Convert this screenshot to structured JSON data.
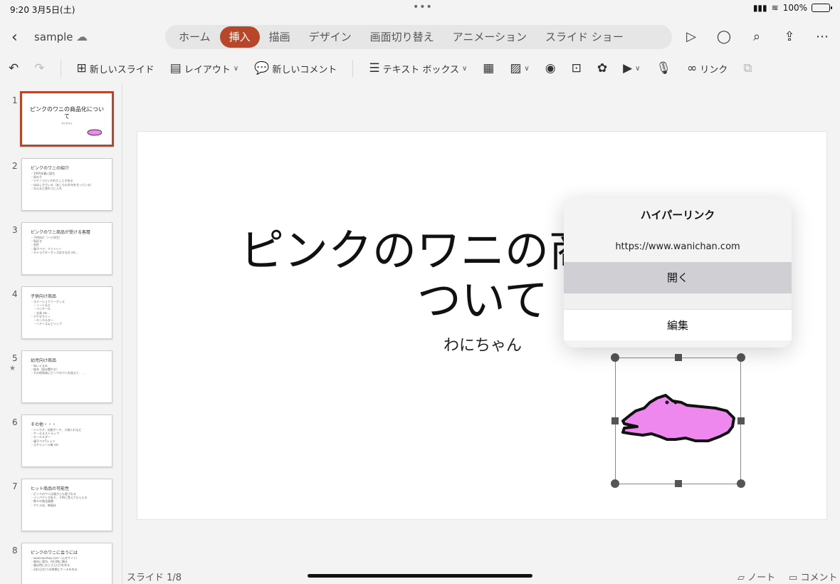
{
  "status": {
    "time": "9:20",
    "date": "3月5日(土)",
    "battery": "100%"
  },
  "document": {
    "name": "sample"
  },
  "tabs": [
    {
      "label": "ホーム",
      "active": false
    },
    {
      "label": "挿入",
      "active": true
    },
    {
      "label": "描画",
      "active": false
    },
    {
      "label": "デザイン",
      "active": false
    },
    {
      "label": "画面切り替え",
      "active": false
    },
    {
      "label": "アニメーション",
      "active": false
    },
    {
      "label": "スライド ショー",
      "active": false
    }
  ],
  "ribbon": {
    "new_slide": "新しいスライド",
    "layout": "レイアウト",
    "new_comment": "新しいコメント",
    "textbox": "テキスト ボックス",
    "link": "リンク"
  },
  "thumbnails": [
    {
      "num": "1",
      "title": "ピンクのワニの商品化について",
      "lines": [
        "わにちゃん"
      ]
    },
    {
      "num": "2",
      "title": "ピンクのワニの紹介",
      "lines": [
        "・1995年春に誕生",
        "・男の子",
        "・ツチノコといわれたことがある",
        "・ほほしかでいる（あこもの文句を言っている）",
        "・ひんなど表れうに入れ"
      ]
    },
    {
      "num": "3",
      "title": "ピンクのワニ商品が受ける客層",
      "lines": [
        "・子供向け（～小学生）",
        "・私好き",
        "・女性",
        "・親子ペア、ファミリー",
        "・キャラクターグッズ好きな方 etc..."
      ]
    },
    {
      "num": "4",
      "title": "子供向け商品",
      "lines": [
        "・ステーショナリーグッズ",
        "　・ノートなど",
        "　・ペンケース",
        "　・文具 etc...",
        "・アクセサリー",
        "　・キーホルダー",
        "　・ヘアーゴムとリップ"
      ]
    },
    {
      "num": "5",
      "title": "幼児向け商品",
      "lines": [
        "・ぬいぐるみ",
        "・絵本（読み聞かせ）",
        "・その他知育にピンクのワニを加えて．．．"
      ]
    },
    {
      "num": "6",
      "title": "その他・・・",
      "lines": [
        "・ハンカチ、化粧ポーチ、小物入れなど",
        "・ケーキ＆ストラップ",
        "・キーホルダー",
        "・親子ペアTシャツ",
        "・スケジュール帳 etc"
      ]
    },
    {
      "num": "7",
      "title": "ヒット商品の可能性",
      "lines": [
        "・ピンクのワニは誰からも愛される",
        "・インパクトがあり、子供に覚えてもらえる",
        "・数々の商品展開",
        "・アニメ化、映画化"
      ]
    },
    {
      "num": "8",
      "title": "ピンクのワニに会うには",
      "lines": [
        "・wanisanshop.com（公式サイト）",
        "・毎年に案内、何日時に開る",
        "・親は特におじさん(さ)を作る",
        "・2年(日か)つの時期にケーキを作る"
      ]
    }
  ],
  "slide": {
    "title_line1": "ピンクのワニの商品化に",
    "title_line2": "ついて",
    "subtitle": "わにちゃん"
  },
  "hyperlink_popup": {
    "title": "ハイパーリンク",
    "url": "https://www.wanichan.com",
    "open": "開く",
    "edit": "編集"
  },
  "footer": {
    "slide_count": "スライド 1/8",
    "notes": "ノート",
    "comments": "コメント"
  },
  "colors": {
    "accent": "#b7472a",
    "croc": "#ee88ee"
  }
}
